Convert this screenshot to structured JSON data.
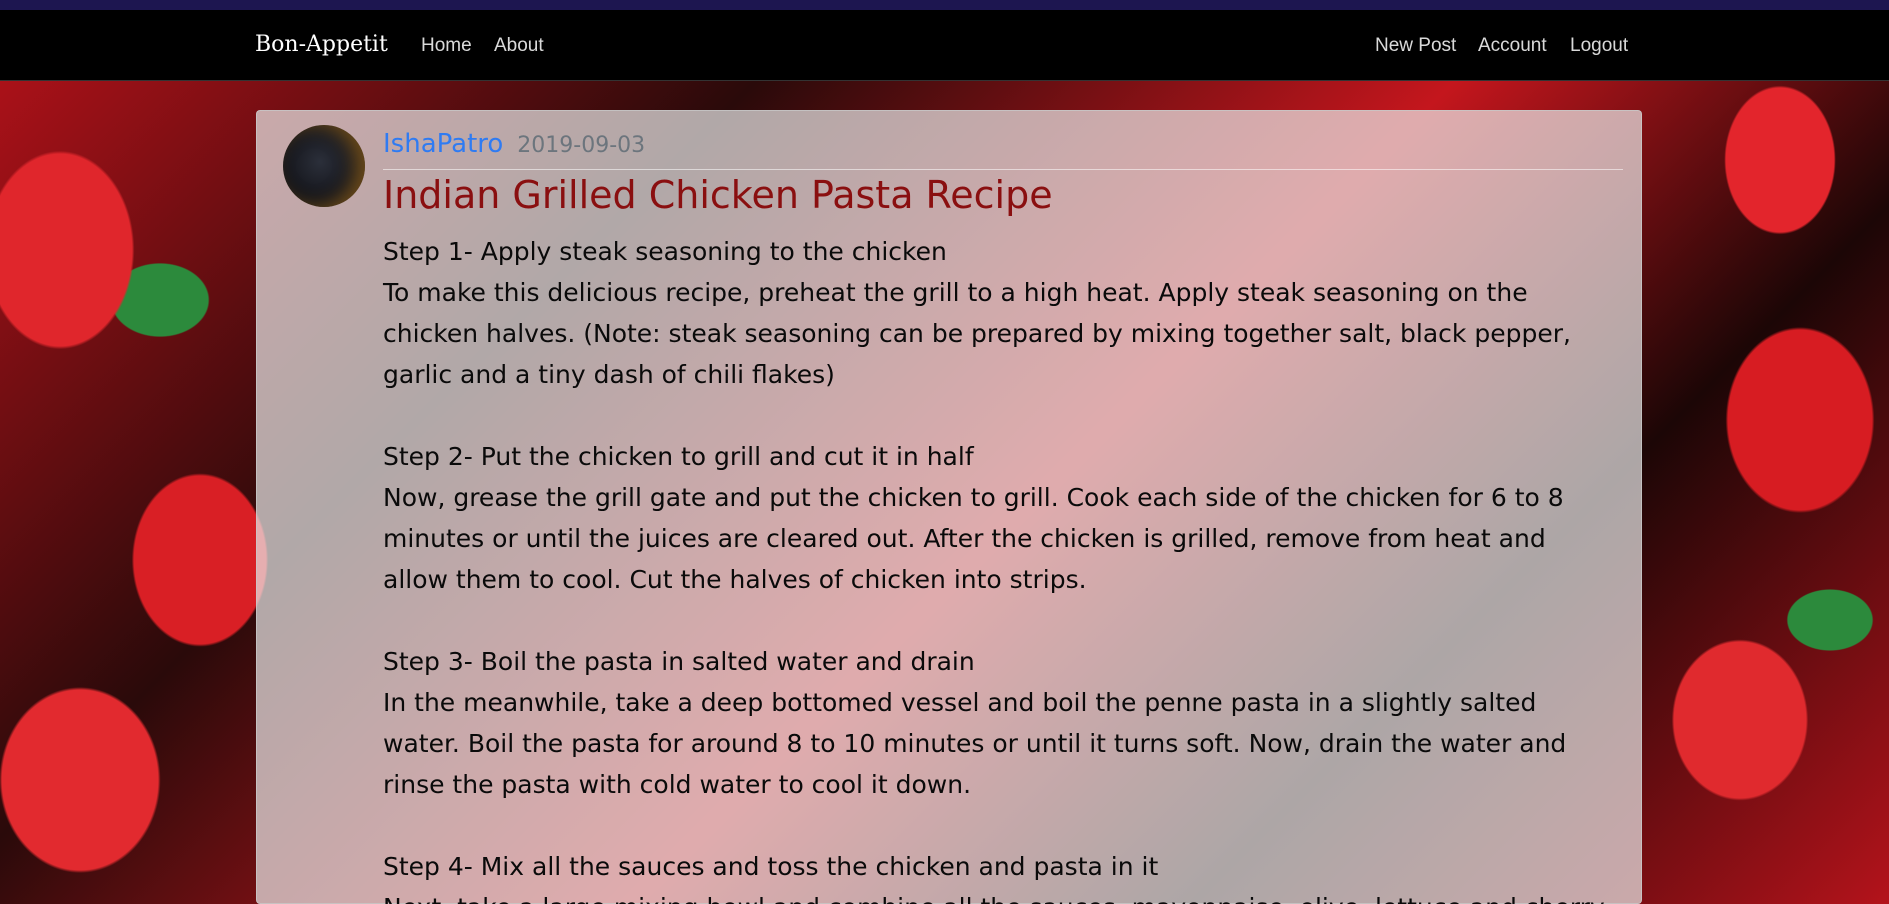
{
  "navbar": {
    "brand": "Bon-Appetit",
    "left_links": [
      "Home",
      "About"
    ],
    "right_links": [
      "New Post",
      "Account",
      "Logout"
    ]
  },
  "post": {
    "author": "IshaPatro",
    "date": "2019-09-03",
    "title": "Indian Grilled Chicken Pasta Recipe",
    "steps": [
      {
        "heading": "Step 1- Apply steak seasoning to the chicken",
        "lines": [
          "To make this delicious recipe, preheat the grill to a high heat. Apply steak seasoning on the",
          "chicken halves. (Note: steak seasoning can be prepared by mixing together salt, black pepper,",
          "garlic and a tiny dash of chili flakes)"
        ]
      },
      {
        "heading": "Step 2- Put the chicken to grill and cut it in half",
        "lines": [
          "Now, grease the grill gate and put the chicken to grill. Cook each side of the chicken for 6 to 8",
          "minutes or until the juices are cleared out. After the chicken is grilled, remove from heat and",
          "allow them to cool. Cut the halves of chicken into strips."
        ]
      },
      {
        "heading": "Step 3- Boil the pasta in salted water and drain",
        "lines": [
          "In the meanwhile, take a deep bottomed vessel and boil the penne pasta in a slightly salted",
          "water. Boil the pasta for around 8 to 10 minutes or until it turns soft. Now, drain the water and",
          "rinse the pasta with cold water to cool it down."
        ]
      },
      {
        "heading": "Step 4- Mix all the sauces and toss the chicken and pasta in it",
        "lines": [
          "Next, take a large mixing bowl and combine all the sauces, mayonnaise, olive, lettuce and cherry"
        ]
      }
    ]
  }
}
